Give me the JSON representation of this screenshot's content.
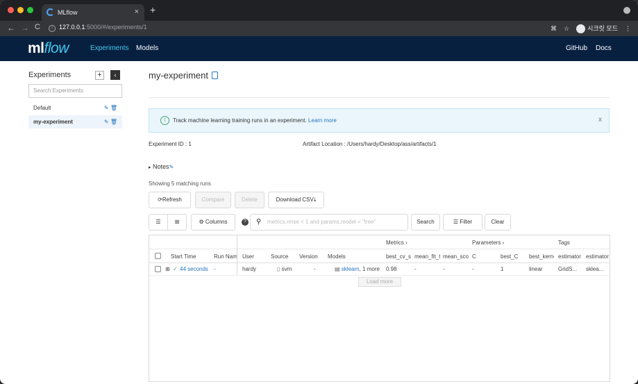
{
  "browser": {
    "tab_title": "MLflow",
    "tab_close": "×",
    "new_tab": "+",
    "url_host": "127.0.0.1",
    "url_path": ":5000/#/experiments/1",
    "incognito_label": "시크릿 모드"
  },
  "app": {
    "logo_ml": "ml",
    "logo_flow": "flow",
    "nav": [
      "Experiments",
      "Models"
    ],
    "nav_right": [
      "GitHub",
      "Docs"
    ]
  },
  "sidebar": {
    "title": "Experiments",
    "add": "+",
    "collapse": "‹",
    "search_placeholder": "Search Experiments",
    "items": [
      {
        "label": "Default"
      },
      {
        "label": "my-experiment"
      }
    ]
  },
  "experiment": {
    "title": "my-experiment",
    "alert_text": "Track machine learning training runs in an experiment.",
    "alert_link": "Learn more",
    "alert_close": "x",
    "id_label": "Experiment ID :",
    "id_value": "1",
    "artifact_label": "Artifact Location :",
    "artifact_value": "/Users/hardy/Desktop/ass/artifacts/1",
    "notes_label": "Notes",
    "showing": "Showing 5 matching runs"
  },
  "toolbar": {
    "refresh": "Refresh",
    "compare": "Compare",
    "delete": "Delete",
    "download": "Download CSV",
    "columns": "Columns",
    "search_placeholder": "metrics.rmse < 1 and params.model = \"tree\"",
    "search_button": "Search",
    "filter": "Filter",
    "clear": "Clear"
  },
  "grid": {
    "group_headers": [
      "Metrics ›",
      "Parameters ›",
      "Tags"
    ],
    "columns": [
      "Start Time",
      "Run Name",
      "User",
      "Source",
      "Version",
      "Models",
      "best_cv_score",
      "mean_fit_time",
      "mean_score_time",
      "C",
      "best_C",
      "best_kernel",
      "estimator",
      "estimator"
    ],
    "row": {
      "start_time": "44 seconds",
      "run_name": "-",
      "user": "hardy",
      "source": "svm",
      "version": "-",
      "model_link": "sklearn",
      "model_more": ", 1 more",
      "best_cv": "0.98",
      "mean_fit": "-",
      "mean_score": "-",
      "c": "-",
      "best_c": "1",
      "best_kernel": "linear",
      "estimator1": "GridS...",
      "estimator2": "sklea..."
    },
    "load_more": "Load more"
  }
}
